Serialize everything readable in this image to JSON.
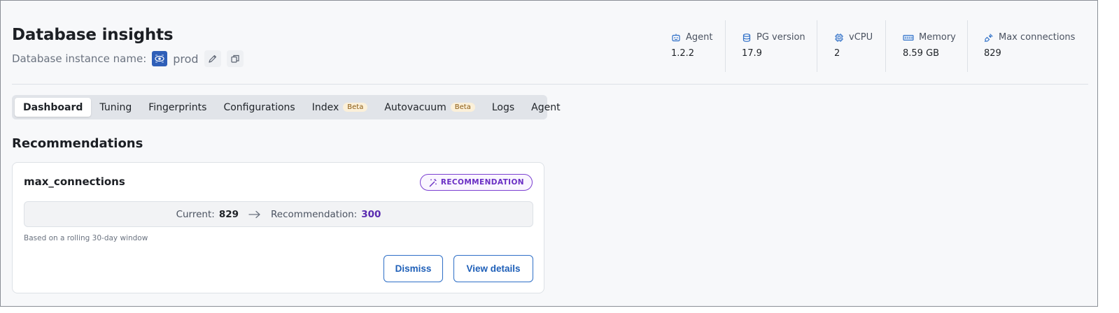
{
  "header": {
    "title": "Database insights",
    "instance_label": "Database instance name:",
    "instance_name": "prod"
  },
  "stats": [
    {
      "label": "Agent",
      "value": "1.2.2",
      "icon": "robot-icon"
    },
    {
      "label": "PG version",
      "value": "17.9",
      "icon": "database-icon"
    },
    {
      "label": "vCPU",
      "value": "2",
      "icon": "cpu-icon"
    },
    {
      "label": "Memory",
      "value": "8.59 GB",
      "icon": "memory-icon"
    },
    {
      "label": "Max connections",
      "value": "829",
      "icon": "plug-icon"
    }
  ],
  "tabs": [
    {
      "label": "Dashboard",
      "active": true,
      "badge": ""
    },
    {
      "label": "Tuning",
      "badge": ""
    },
    {
      "label": "Fingerprints",
      "badge": ""
    },
    {
      "label": "Configurations",
      "badge": ""
    },
    {
      "label": "Index",
      "badge": "Beta"
    },
    {
      "label": "Autovacuum",
      "badge": "Beta"
    },
    {
      "label": "Logs",
      "badge": ""
    },
    {
      "label": "Agent",
      "badge": ""
    }
  ],
  "recommendations": {
    "section_title": "Recommendations",
    "card": {
      "title": "max_connections",
      "badge": "RECOMMENDATION",
      "current_label": "Current:",
      "current_value": "829",
      "recommendation_label": "Recommendation:",
      "recommendation_value": "300",
      "note": "Based on a rolling 30-day window",
      "dismiss_label": "Dismiss",
      "details_label": "View details"
    }
  },
  "colors": {
    "accent": "#1e5fb8",
    "recommendation": "#6a2fc4",
    "beta_bg": "#fbf0d9"
  }
}
